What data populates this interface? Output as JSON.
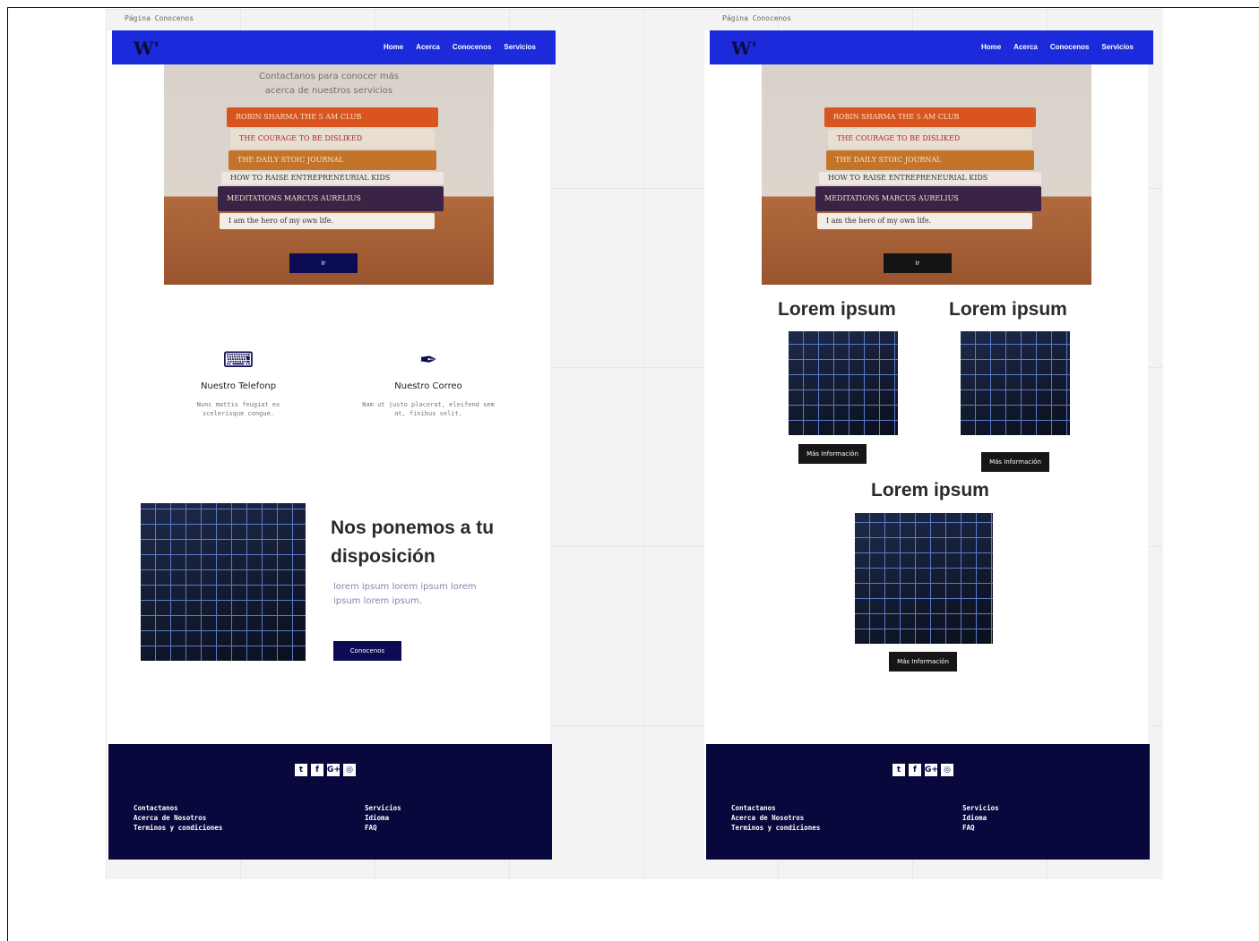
{
  "left": {
    "frame_label": "Página Conocenos",
    "nav": [
      "Home",
      "Acerca",
      "Conocenos",
      "Servicios"
    ],
    "hero_text": "Contactanos para conocer más acerca de nuestros servicios",
    "hero_button": "Ir",
    "features": [
      {
        "title": "Nuestro Telefonp",
        "desc": "Nunc mattis feugiat ex scelerisque congue.",
        "icon": "keyboard-icon"
      },
      {
        "title": "Nuestro Correo",
        "desc": "Nam ut justo placerat, eleifend sem at, finibus velit.",
        "icon": "feather-icon"
      }
    ],
    "section_title": "Nos ponemos a tu disposición",
    "section_text": "lorem ipsum lorem ipsum lorem ipsum lorem ipsum.",
    "section_button": "Conocenos"
  },
  "right": {
    "frame_label": "Página Conocenos",
    "nav": [
      "Home",
      "Acerca",
      "Conocenos",
      "Servicios"
    ],
    "hero_button": "Ir",
    "cards": [
      {
        "title": "Lorem ipsum",
        "button": "Más Información"
      },
      {
        "title": "Lorem ipsum",
        "button": "Más Información"
      },
      {
        "title": "Lorem ipsum",
        "button": "Más Información"
      }
    ]
  },
  "books": [
    "ROBIN SHARMA   THE 5 AM CLUB",
    "THE COURAGE TO BE DISLIKED",
    "THE DAILY STOIC JOURNAL",
    "HOW TO RAISE ENTREPRENEURIAL KIDS",
    "MEDITATIONS   MARCUS AURELIUS",
    "I am the hero of my own life."
  ],
  "footer": {
    "social": [
      "t",
      "f",
      "G+",
      "◎"
    ],
    "col1": [
      "Contactanos",
      "Acerca de Nosotros",
      "Terminos y condiciones"
    ],
    "col2": [
      "Servicios",
      "Idioma",
      "FAQ"
    ]
  },
  "colors": {
    "nav": "#1b2bdb",
    "footer": "#08083d",
    "button": "#0c0c54"
  }
}
